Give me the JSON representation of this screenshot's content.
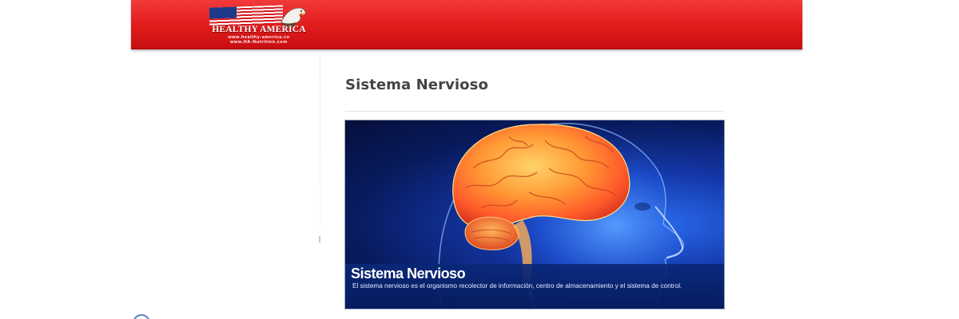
{
  "header": {
    "logo": {
      "title": "HEALTHY AMERICA",
      "url_1": "www.healthy-america.co",
      "url_2": "www.HA-Nutrition.com",
      "icon": "eagle-flag-logo"
    },
    "colors": {
      "bar": "#e11b1b",
      "bar_dark": "#c80f12"
    }
  },
  "main": {
    "page_title": "Sistema Nervioso",
    "banner": {
      "title": "Sistema Nervioso",
      "description": "El sistema nervioso es el organismo recolector de información, centro de almacenamiento y el sistema de control.",
      "colors": {
        "brain": "#ff8a2a",
        "head": "#2a6cf0",
        "caption_bg": "#0a2878"
      }
    }
  }
}
